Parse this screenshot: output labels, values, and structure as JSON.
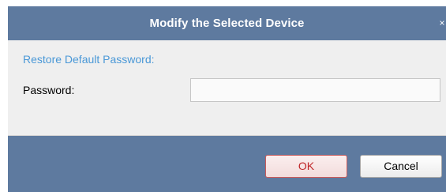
{
  "dialog": {
    "title": "Modify the Selected Device",
    "close_glyph": "×"
  },
  "section": {
    "label": "Restore Default Password:"
  },
  "password": {
    "label": "Password:",
    "value": "",
    "placeholder": ""
  },
  "buttons": {
    "ok_label": "OK",
    "cancel_label": "Cancel"
  },
  "colors": {
    "titlebar": "#5e7a9f",
    "section_label": "#4a98d7",
    "ok_border": "#c95b5b",
    "ok_text": "#c0282a"
  }
}
